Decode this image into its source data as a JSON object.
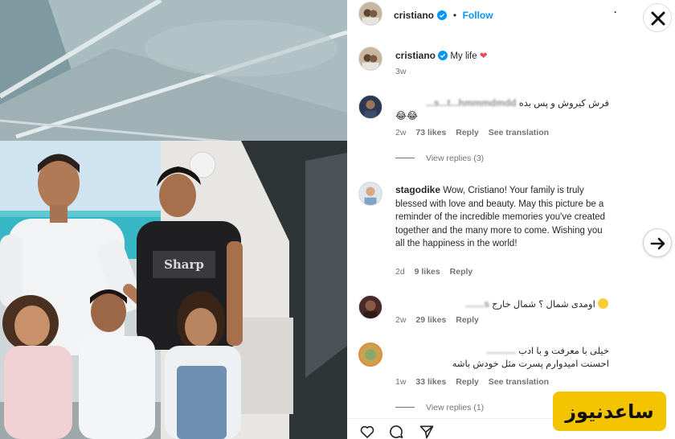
{
  "photo": {
    "alt_subject": "family-on-yacht"
  },
  "header": {
    "username": "cristiano",
    "separator": "•",
    "follow_label": "Follow",
    "more_label": "·"
  },
  "caption": {
    "username": "cristiano",
    "text": "My life",
    "emoji": "❤",
    "age": "3w"
  },
  "comments": [
    {
      "username_obscured": "s...t...hmmmdmdd...",
      "text": "فرش کیروش و پس بده",
      "reactions": "😂😂",
      "age": "2w",
      "likes": "73 likes",
      "reply_label": "Reply",
      "translate_label": "See translation",
      "view_replies": "View replies (3)"
    },
    {
      "username": "stagodike",
      "text": "Wow, Cristiano! Your family is truly blessed with love and beauty. May this picture be a reminder of the incredible memories you've created together and the many more to come. Wishing you all the happiness in the world!",
      "age": "2d",
      "likes": "9 likes",
      "reply_label": "Reply"
    },
    {
      "username_obscured": "s.......",
      "text": "اومدی شمال ؟ شمال خارج",
      "age": "2w",
      "likes": "29 likes",
      "reply_label": "Reply"
    },
    {
      "username_obscured": "...........",
      "text_line1": "خیلی با معرفت و با ادب",
      "text_line2": "احسنت امیدوارم پسرت مثل خودش باشه",
      "age": "1w",
      "likes": "33 likes",
      "reply_label": "Reply",
      "translate_label": "See translation",
      "view_replies": "View replies (1)"
    }
  ],
  "actions": {
    "like_icon": "heart-icon",
    "comment_icon": "comment-icon",
    "share_icon": "share-icon"
  },
  "controls": {
    "close_icon": "close-icon",
    "next_icon": "arrow-right-icon"
  },
  "watermark": {
    "text": "ساعدنیوز"
  },
  "colors": {
    "accent": "#0095f6",
    "text": "#262626",
    "muted": "#737373",
    "heart": "#ed4956",
    "watermark_bg": "#f5c400"
  }
}
